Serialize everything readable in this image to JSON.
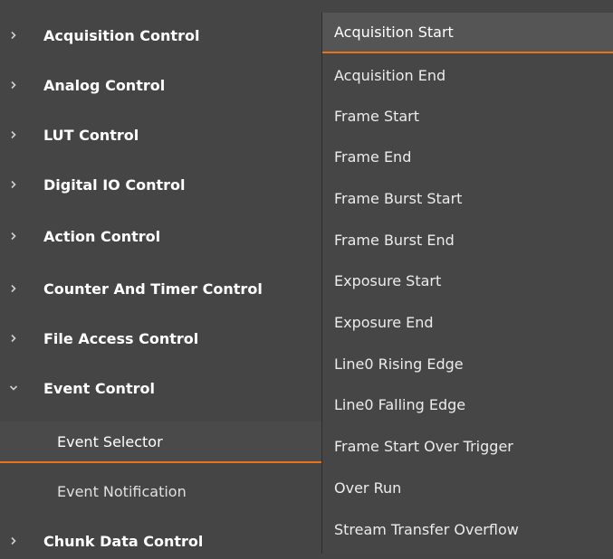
{
  "tree": {
    "items": [
      {
        "label": "Acquisition Control",
        "expanded": false
      },
      {
        "label": "Analog Control",
        "expanded": false
      },
      {
        "label": "LUT Control",
        "expanded": false
      },
      {
        "label": "Digital IO Control",
        "expanded": false
      },
      {
        "label": "Action Control",
        "expanded": false
      },
      {
        "label": "Counter And Timer Control",
        "expanded": false
      },
      {
        "label": "File Access Control",
        "expanded": false
      },
      {
        "label": "Event Control",
        "expanded": true
      },
      {
        "label": "Chunk Data Control",
        "expanded": false
      }
    ],
    "children": [
      {
        "label": "Event Selector"
      },
      {
        "label": "Event Notification"
      }
    ]
  },
  "dropdown": {
    "selected": "Acquisition Start",
    "options": [
      "Acquisition Start",
      "Acquisition End",
      "Frame Start",
      "Frame End",
      "Frame Burst Start",
      "Frame Burst End",
      "Exposure Start",
      "Exposure End",
      "Line0 Rising Edge",
      "Line0 Falling Edge",
      "Frame Start Over Trigger",
      "Over Run",
      "Stream Transfer Overflow"
    ]
  },
  "colors": {
    "background": "#454545",
    "accent": "#e8731b",
    "text": "#ffffff"
  }
}
